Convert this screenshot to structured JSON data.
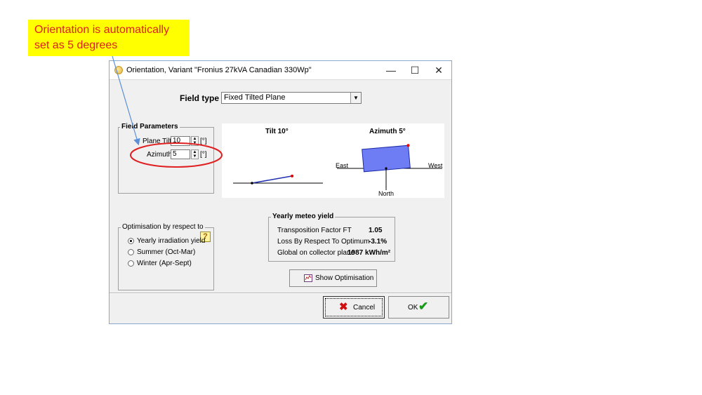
{
  "annotation": {
    "line1": "Orientation is automatically",
    "line2": "set as 5 degrees",
    "color": "#e0201c",
    "background": "#ffff00"
  },
  "window": {
    "title": "Orientation, Variant \"Fronius 27kVA Canadian 330Wp\"",
    "minimize_glyph": "—",
    "maximize_glyph": "☐",
    "close_glyph": "✕"
  },
  "field_type": {
    "label": "Field type",
    "value": "Fixed Tilted Plane"
  },
  "field_parameters": {
    "title": "Field Parameters",
    "plane_tilt_label": "Plane Tilt",
    "plane_tilt_value": "10",
    "azimuth_label": "Azimuth",
    "azimuth_value": "5",
    "unit": "[°]"
  },
  "diagram": {
    "tilt_title": "Tilt 10°",
    "azimuth_title": "Azimuth 5°",
    "east": "East",
    "west": "West",
    "north": "North",
    "tilt_deg": 10,
    "azimuth_deg": 5,
    "plane_color": "#6f7df5"
  },
  "optimisation": {
    "title": "Optimisation by respect to",
    "options": [
      "Yearly irradiation yield",
      "Summer (Oct-Mar)",
      "Winter (Apr-Sept)"
    ],
    "selected": 0,
    "help_glyph": "?"
  },
  "meteo": {
    "title": "Yearly meteo yield",
    "rows": [
      {
        "label": "Transposition Factor FT",
        "value": "1.05"
      },
      {
        "label": "Loss By Respect To Optimum",
        "value": "-3.1%"
      },
      {
        "label": "Global on collector plane",
        "value": "1987 kWh/m²"
      }
    ]
  },
  "buttons": {
    "show_optimisation": "Show Optimisation",
    "cancel": "Cancel",
    "ok": "OK"
  }
}
